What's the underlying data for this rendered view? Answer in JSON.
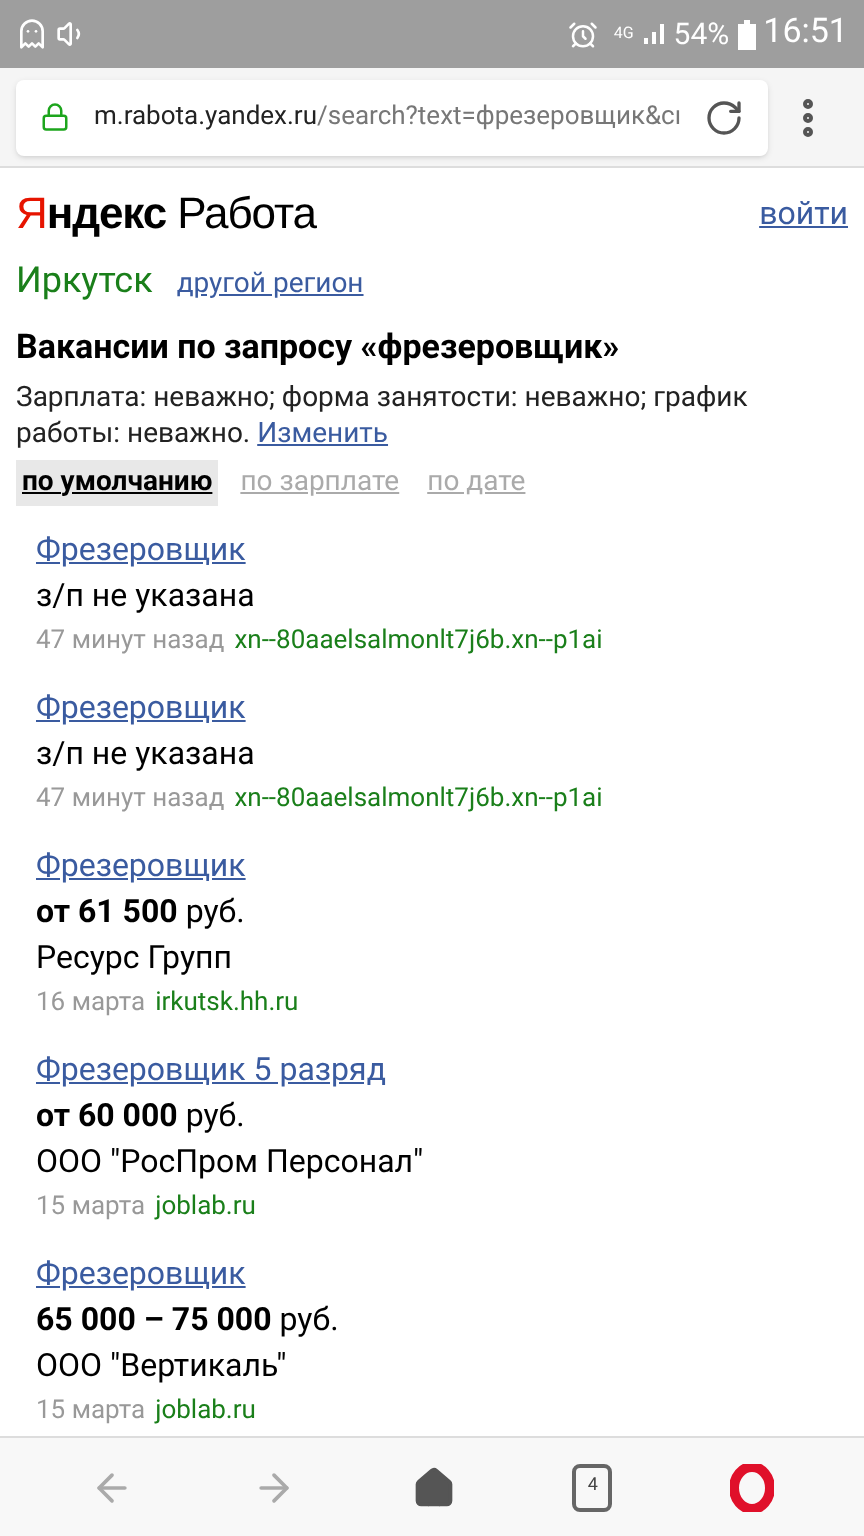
{
  "status_bar": {
    "network": "4G",
    "battery": "54%",
    "time": "16:51"
  },
  "address_bar": {
    "host": "m.rabota.yandex.ru",
    "path": "/search?text=фрезеровщик&сı",
    "secure": true
  },
  "header": {
    "logo_initial": "Я",
    "logo_rest": "ндекс",
    "logo_product": "Работа",
    "login": "войти"
  },
  "region": {
    "city": "Иркутск",
    "change": "другой регион"
  },
  "heading": "Вакансии по запросу «фрезеровщик»",
  "filters": {
    "text": "Зарплата: неважно; форма занятости: неважно; график работы: неважно.",
    "edit": "Изменить"
  },
  "sort_tabs": [
    {
      "label": "по умолчанию",
      "selected": true
    },
    {
      "label": "по зарплате",
      "selected": false
    },
    {
      "label": "по дате",
      "selected": false
    }
  ],
  "vacancies": [
    {
      "title": "Фрезеровщик",
      "salary": "з/п не указана",
      "date": "47 минут назад",
      "source": "xn--80aaelsalmonlt7j6b.xn--p1ai"
    },
    {
      "title": "Фрезеровщик",
      "salary": "з/п не указана",
      "date": "47 минут назад",
      "source": "xn--80aaelsalmonlt7j6b.xn--p1ai"
    },
    {
      "title": "Фрезеровщик",
      "salary": "**от 61 500** руб.",
      "company": "Ресурс Групп",
      "date": "16 марта",
      "source": "irkutsk.hh.ru"
    },
    {
      "title": "Фрезеровщик 5 разряд",
      "salary": "**от 60 000** руб.",
      "company": "ООО \"РосПром Персонал\"",
      "date": "15 марта",
      "source": "joblab.ru"
    },
    {
      "title": "Фрезеровщик",
      "salary": "**65 000 – 75 000** руб.",
      "company": "ООО \"Вертикаль\"",
      "date": "15 марта",
      "source": "joblab.ru"
    }
  ],
  "bottom_bar": {
    "tab_count": "4"
  }
}
